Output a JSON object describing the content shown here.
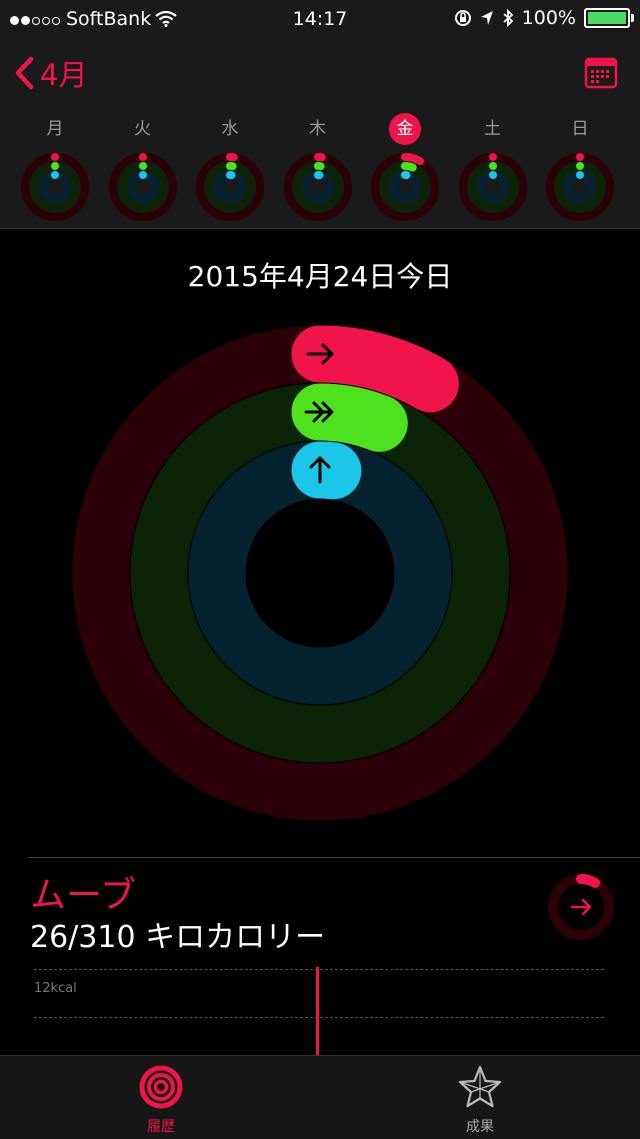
{
  "status_bar": {
    "carrier": "SoftBank",
    "time": "14:17",
    "battery": "100%",
    "icons": [
      "wifi-icon",
      "lock-rotation-icon",
      "location-icon",
      "bluetooth-icon",
      "battery-icon"
    ]
  },
  "nav": {
    "back_label": "4月",
    "calendar_icon": "calendar-icon"
  },
  "week": {
    "days": [
      {
        "label": "月",
        "today": false,
        "move": 0,
        "exercise": 0,
        "stand": 0
      },
      {
        "label": "火",
        "today": false,
        "move": 0,
        "exercise": 0,
        "stand": 0
      },
      {
        "label": "水",
        "today": false,
        "move": 0.02,
        "exercise": 0.02,
        "stand": 0.02
      },
      {
        "label": "木",
        "today": false,
        "move": 0.02,
        "exercise": 0.02,
        "stand": 0.02
      },
      {
        "label": "金",
        "today": true,
        "move": 0.084,
        "exercise": 0.06,
        "stand": 0.02
      },
      {
        "label": "土",
        "today": false,
        "move": 0,
        "exercise": 0,
        "stand": 0
      },
      {
        "label": "日",
        "today": false,
        "move": 0,
        "exercise": 0,
        "stand": 0
      }
    ]
  },
  "date_title": "2015年4月24日今日",
  "rings": {
    "move_progress": 0.084,
    "exercise_progress": 0.06,
    "stand_progress": 0.02,
    "colors": {
      "move": "#f0144a",
      "exercise": "#4ee21e",
      "stand": "#1cc6e8",
      "move_track": "#2b0008",
      "exercise_track": "#0b2406",
      "stand_track": "#042230"
    }
  },
  "move_detail": {
    "title": "ムーブ",
    "value": "26/310 キロカロリー",
    "y_tick": "12kcal",
    "bar_value_kcal": 12
  },
  "tabs": [
    {
      "label": "履歴",
      "icon": "activity-rings-icon",
      "active": true
    },
    {
      "label": "成果",
      "icon": "star-icon",
      "active": false
    }
  ],
  "accent_color": "#f0144a"
}
